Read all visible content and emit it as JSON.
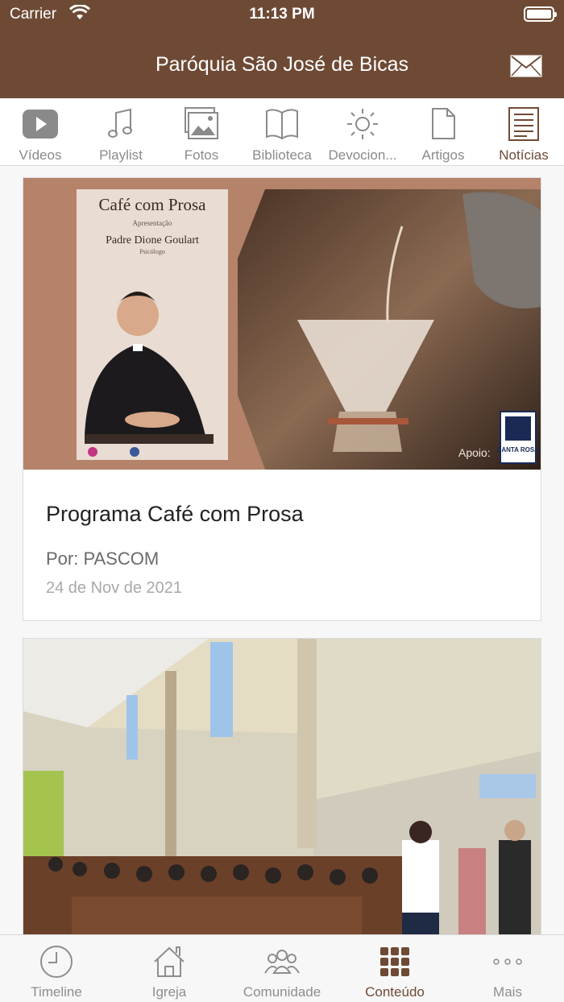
{
  "status": {
    "carrier": "Carrier",
    "time": "11:13 PM",
    "battery_level": 1.0
  },
  "header": {
    "title": "Paróquia São José de Bicas",
    "mail_icon": "envelope-icon"
  },
  "tabs": [
    {
      "label": "Vídeos",
      "icon": "play-icon",
      "active": false
    },
    {
      "label": "Playlist",
      "icon": "music-note-icon",
      "active": false
    },
    {
      "label": "Fotos",
      "icon": "photos-icon",
      "active": false
    },
    {
      "label": "Biblioteca",
      "icon": "book-icon",
      "active": false
    },
    {
      "label": "Devocion...",
      "icon": "sun-icon",
      "active": false
    },
    {
      "label": "Artigos",
      "icon": "document-icon",
      "active": false
    },
    {
      "label": "Notícias",
      "icon": "newspaper-icon",
      "active": true
    }
  ],
  "feed": {
    "cards": [
      {
        "title": "Programa Café com Prosa",
        "author": "Por: PASCOM",
        "date": "24 de Nov de 2021",
        "poster": {
          "heading": "Café com Prosa",
          "sub": "Apresentação",
          "name": "Padre Dione Goulart",
          "role": "Psicólogo",
          "sponsor_label": "Apoio:",
          "sponsor_logo_text": "SANTA ROSA"
        }
      },
      {
        "title": "",
        "author": "",
        "date": ""
      }
    ]
  },
  "bottom_tabs": [
    {
      "label": "Timeline",
      "icon": "clock-icon",
      "active": false
    },
    {
      "label": "Igreja",
      "icon": "church-icon",
      "active": false
    },
    {
      "label": "Comunidade",
      "icon": "people-icon",
      "active": false
    },
    {
      "label": "Conteúdo",
      "icon": "grid-icon",
      "active": true
    },
    {
      "label": "Mais",
      "icon": "more-dots-icon",
      "active": false
    }
  ],
  "colors": {
    "brand": "#6e4a35",
    "inactive": "#8a8a8a"
  }
}
